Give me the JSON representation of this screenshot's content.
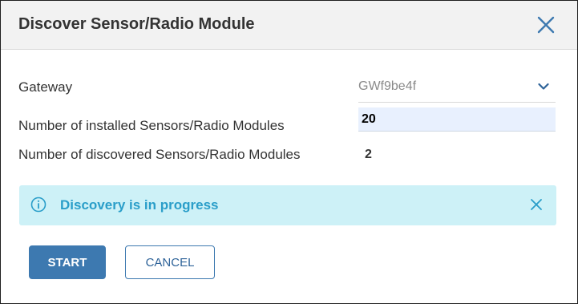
{
  "dialog": {
    "title": "Discover Sensor/Radio Module",
    "close_icon": "close-icon"
  },
  "form": {
    "gateway": {
      "label": "Gateway",
      "value": "GWf9be4f",
      "icon": "chevron-down-icon"
    },
    "installed": {
      "label": "Number of installed Sensors/Radio Modules",
      "value": "20"
    },
    "discovered": {
      "label": "Number of discovered Sensors/Radio Modules",
      "value": "2"
    }
  },
  "alert": {
    "message": "Discovery is in progress",
    "icon": "info-icon",
    "close_icon": "close-icon",
    "background": "#cdf1f7",
    "text_color": "#2a9ec9"
  },
  "actions": {
    "start_label": "START",
    "cancel_label": "CANCEL"
  },
  "colors": {
    "primary": "#3d79b0",
    "header_bg": "#f2f2f2",
    "input_bg": "#e8f0fe"
  }
}
